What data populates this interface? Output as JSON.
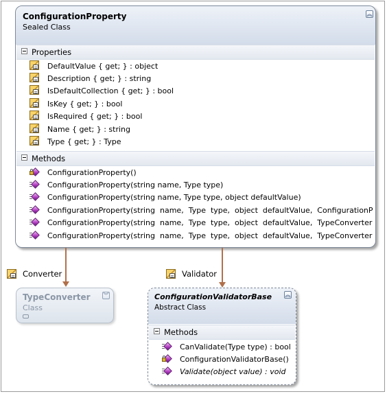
{
  "main_class": {
    "name": "ConfigurationProperty",
    "kind": "Sealed Class",
    "sections": [
      {
        "title": "Properties",
        "items": [
          {
            "icon": "property-icon",
            "text": "DefaultValue { get; } : object"
          },
          {
            "icon": "property-icon",
            "text": "Description { get; } : string"
          },
          {
            "icon": "property-icon",
            "text": "IsDefaultCollection { get; } : bool"
          },
          {
            "icon": "property-icon",
            "text": "IsKey { get; } : bool"
          },
          {
            "icon": "property-icon",
            "text": "IsRequired { get; } : bool"
          },
          {
            "icon": "property-icon",
            "text": "Name { get; } : string"
          },
          {
            "icon": "property-icon",
            "text": "Type { get; } : Type"
          }
        ]
      },
      {
        "title": "Methods",
        "items": [
          {
            "icon": "private-method-icon",
            "text": "ConfigurationProperty()"
          },
          {
            "icon": "method-icon",
            "text": "ConfigurationProperty(string name, Type type)"
          },
          {
            "icon": "method-icon",
            "text": "ConfigurationProperty(string name, Type type, object defaultValue)"
          },
          {
            "icon": "method-icon",
            "text": "ConfigurationProperty(string  name,  Type  type,  object  defaultValue,  ConfigurationProp..."
          },
          {
            "icon": "method-icon",
            "text": "ConfigurationProperty(string  name,  Type  type,  object  defaultValue,  TypeConverter  typ..."
          },
          {
            "icon": "method-icon",
            "text": "ConfigurationProperty(string  name,  Type  type,  object  defaultValue,  TypeConverter  typ..."
          }
        ]
      }
    ]
  },
  "associations": [
    {
      "label": "Converter"
    },
    {
      "label": "Validator"
    }
  ],
  "type_converter": {
    "name": "TypeConverter",
    "kind": "Class"
  },
  "validator_base": {
    "name": "ConfigurationValidatorBase",
    "kind": "Abstract Class",
    "section_title": "Methods",
    "items": [
      {
        "icon": "method-icon",
        "text": "CanValidate(Type type) : bool"
      },
      {
        "icon": "private-method-icon",
        "text": "ConfigurationValidatorBase()"
      },
      {
        "icon": "method-icon",
        "text": "Validate(object value) : void"
      }
    ]
  },
  "colors": {
    "header_blue": "#d6e0ee",
    "section_bg": "#e8ecf2",
    "connector": "#b0704a",
    "muted_class_header": "#dde4ec"
  }
}
